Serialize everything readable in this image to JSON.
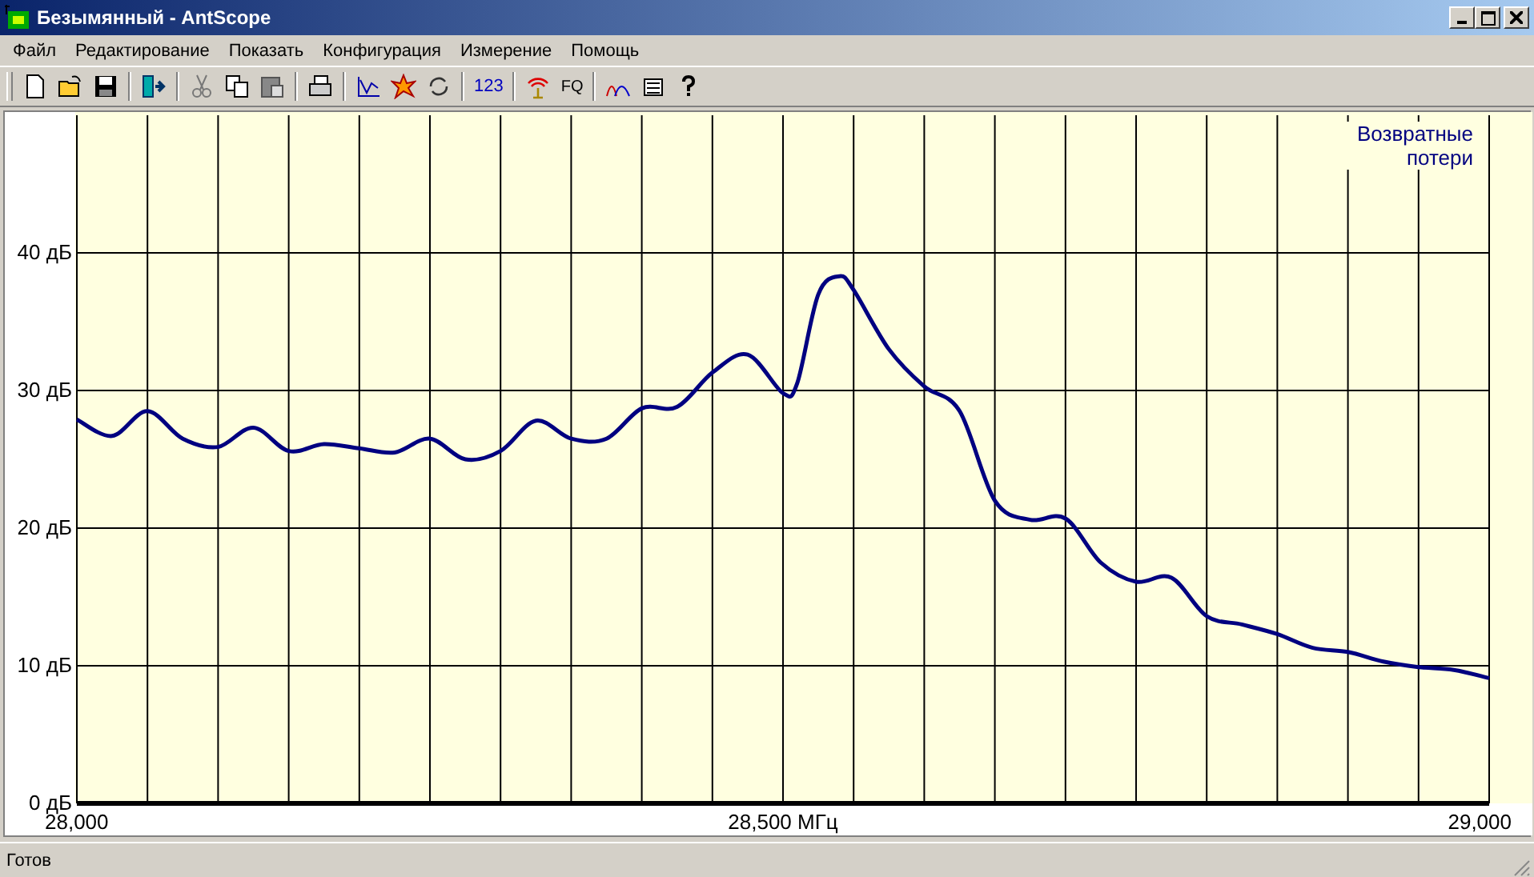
{
  "window": {
    "title": "Безымянный - AntScope"
  },
  "menu": [
    "Файл",
    "Редактирование",
    "Показать",
    "Конфигурация",
    "Измерение",
    "Помощь"
  ],
  "toolbar": {
    "text_buttons": [
      "123",
      "FQ"
    ]
  },
  "chart": {
    "chart_data": {
      "type": "line",
      "grid": true,
      "xlim": [
        28000,
        29000
      ],
      "ylim": [
        0,
        50
      ],
      "xticks": [
        {
          "value": 28000,
          "label": "28,000"
        },
        {
          "value": 28500,
          "label": "28,500 МГц"
        },
        {
          "value": 29000,
          "label": "29,000"
        }
      ],
      "yticks": [
        {
          "value": 0,
          "label": "0 дБ"
        },
        {
          "value": 10,
          "label": "10 дБ"
        },
        {
          "value": 20,
          "label": "20 дБ"
        },
        {
          "value": 30,
          "label": "30 дБ"
        },
        {
          "value": 40,
          "label": "40 дБ"
        }
      ],
      "x": [
        28000,
        28025,
        28050,
        28075,
        28100,
        28125,
        28150,
        28175,
        28200,
        28225,
        28250,
        28275,
        28300,
        28325,
        28350,
        28375,
        28400,
        28425,
        28450,
        28475,
        28500,
        28510,
        28525,
        28540,
        28550,
        28575,
        28600,
        28625,
        28650,
        28675,
        28700,
        28725,
        28750,
        28775,
        28800,
        28825,
        28850,
        28875,
        28900,
        28925,
        28950,
        28975,
        29000
      ],
      "series": [
        {
          "name": "Возвратные потери",
          "color": "#000080",
          "values": [
            27.9,
            26.7,
            28.5,
            26.5,
            25.9,
            27.3,
            25.6,
            26.1,
            25.8,
            25.5,
            26.5,
            25.0,
            25.6,
            27.8,
            26.5,
            26.5,
            28.7,
            28.8,
            31.3,
            32.6,
            29.8,
            30.5,
            37.0,
            38.3,
            37.3,
            33.0,
            30.3,
            28.5,
            22.0,
            20.6,
            20.7,
            17.5,
            16.1,
            16.4,
            13.6,
            13.0,
            12.3,
            11.3,
            11.0,
            10.3,
            9.9,
            9.7,
            9.1
          ]
        }
      ]
    }
  },
  "status_bar": {
    "text": "Готов"
  }
}
